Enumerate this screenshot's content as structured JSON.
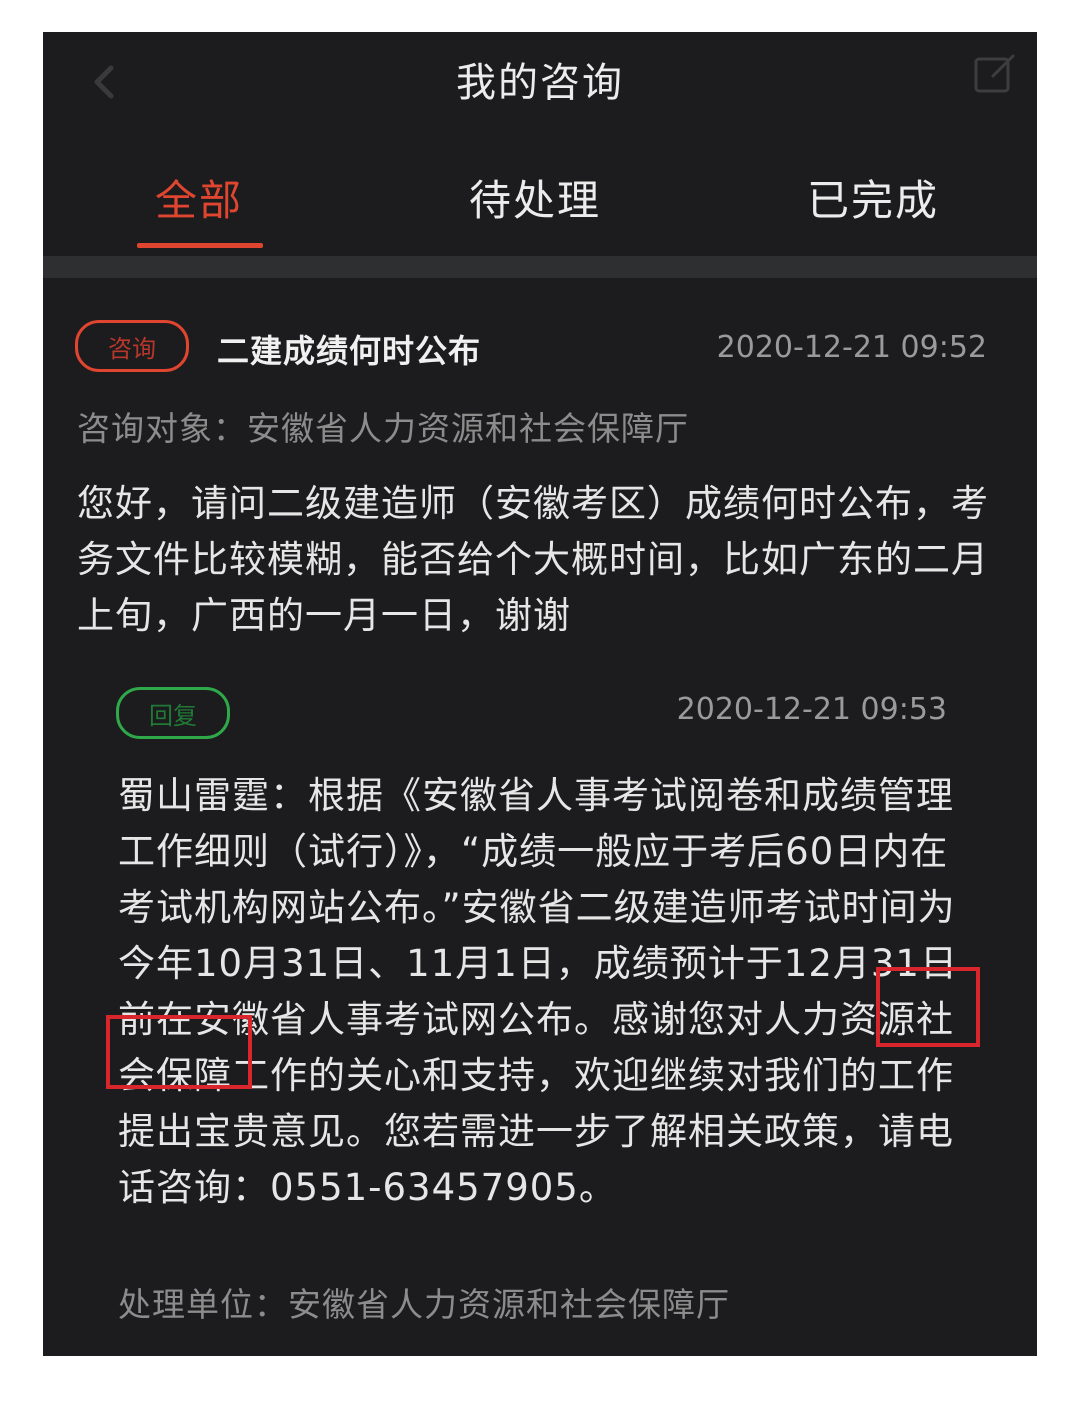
{
  "header": {
    "title": "我的咨询"
  },
  "tabs": [
    {
      "label": "全部",
      "active": true
    },
    {
      "label": "待处理",
      "active": false
    },
    {
      "label": "已完成",
      "active": false
    }
  ],
  "item": {
    "tag": "咨询",
    "title": "二建成绩何时公布",
    "time": "2020-12-21 09:52",
    "target": "咨询对象：安徽省人力资源和社会保障厅",
    "question": "您好，请问二级建造师（安徽考区）成绩何时公布，考务文件比较模糊，能否给个大概时间，比如广东的二月上旬，广西的一月一日，谢谢",
    "reply": {
      "tag": "回复",
      "time": "2020-12-21 09:53",
      "text": "蜀山雷霆：根据《安徽省人事考试阅卷和成绩管理工作细则（试行）》，“成绩一般应于考后60日内在考试机构网站公布。”安徽省二级建造师考试时间为今年10月31日、11月1日，成绩预计于12月31日前在安徽省人事考试网公布。感谢您对人力资源社会保障工作的关心和支持，欢迎继续对我们的工作提出宝贵意见。您若需进一步了解相关政策，请电话咨询：0551-63457905。",
      "handler": "处理单位：安徽省人力资源和社会保障厅"
    }
  },
  "colors": {
    "accent": "#e0452f",
    "reply": "#2fa84a",
    "highlight": "#d8262c",
    "background": "#1c1c1e"
  }
}
